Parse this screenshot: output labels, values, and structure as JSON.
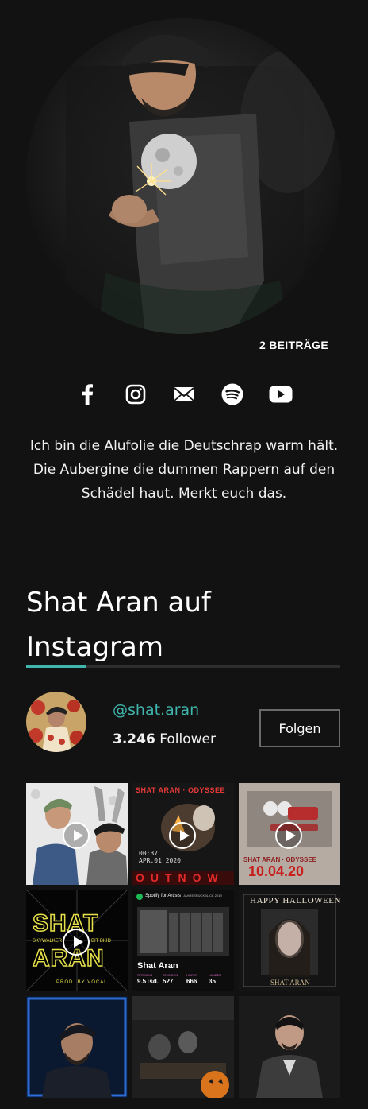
{
  "profile": {
    "posts_label": "2 BEITRÄGE",
    "bio": "Ich bin die Alufolie die Deutschrap warm hält. Die Aubergine die dummen Rappern auf den Schädel haut. Merkt euch das.",
    "socials": [
      {
        "name": "facebook",
        "icon": "facebook-icon"
      },
      {
        "name": "instagram",
        "icon": "instagram-icon"
      },
      {
        "name": "email",
        "icon": "mail-icon"
      },
      {
        "name": "spotify",
        "icon": "spotify-icon"
      },
      {
        "name": "youtube",
        "icon": "youtube-icon"
      }
    ]
  },
  "instagram_widget": {
    "title": "Shat Aran auf Instagram",
    "accent_color": "#3fb5ad",
    "handle": "@shat.aran",
    "followers_count": "3.246",
    "followers_label": "Follower",
    "follow_button": "Folgen",
    "posts": [
      {
        "type": "video",
        "overlay": [],
        "top_text": ""
      },
      {
        "type": "video",
        "overlay": [
          "00:37",
          "APR.01 2020"
        ],
        "top_text": "SHAT ARAN · ODYSSEE",
        "bottom_text": "OUTNOW"
      },
      {
        "type": "video",
        "overlay": [],
        "top_text": "",
        "bottom_text": "10.04.20",
        "mid_text": "SHAT ARAN · ODYSSEE"
      },
      {
        "type": "video",
        "overlay": [
          "SHAT",
          "ARAN",
          "SKYWALKER",
          "BIT BKID",
          "PROD. BY VOCAL"
        ]
      },
      {
        "type": "image",
        "brand": "Spotify for Artists",
        "heading": "JAHRESRÜCKBLICK 2019",
        "artist": "Shat Aran",
        "stats": [
          {
            "label": "STREAMS",
            "value": "9.5Tsd."
          },
          {
            "label": "STUNDEN",
            "value": "527"
          },
          {
            "label": "HÖRER",
            "value": "666"
          },
          {
            "label": "LÄNDER",
            "value": "35"
          }
        ]
      },
      {
        "type": "image",
        "top_text": "HAPPY HALLOWEEN",
        "bottom_text": "SHAT ARAN"
      },
      {
        "type": "image"
      },
      {
        "type": "image"
      },
      {
        "type": "image"
      }
    ]
  }
}
